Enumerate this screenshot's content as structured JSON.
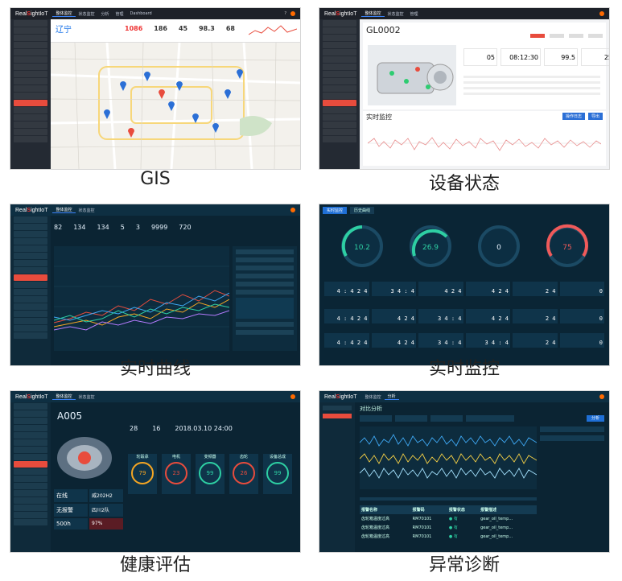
{
  "captions": [
    "GIS",
    "设备状态",
    "实时曲线",
    "实时监控",
    "健康评估",
    "异常诊断"
  ],
  "brand": "RealSightIoT",
  "gis": {
    "region": "辽宁",
    "stats": [
      {
        "value": "1086",
        "color": "#e33"
      },
      {
        "value": "186"
      },
      {
        "value": "45"
      },
      {
        "value": "98.3"
      },
      {
        "value": "68"
      }
    ],
    "nav": [
      "整体监控",
      "状态监控",
      "分析",
      "管理",
      "Dashboard"
    ]
  },
  "device": {
    "id": "GL0002",
    "realtime_title": "实时监控",
    "gauges": [
      "05",
      "08:12:30",
      "99.5",
      "25"
    ],
    "buttons": [
      "操作日志",
      "导出"
    ]
  },
  "curve": {
    "kpis": [
      "82",
      "134",
      "134",
      "5",
      "3",
      "9999",
      "720"
    ],
    "legend": [
      "实时曲线数据"
    ]
  },
  "monitor": {
    "tabs": [
      "实时监控",
      "历史曲线"
    ],
    "gauges": [
      {
        "value": "10.2",
        "color": "#2ecfa3"
      },
      {
        "value": "26.9",
        "color": "#2ecfa3"
      },
      {
        "value": "0",
        "color": "#8aa"
      },
      {
        "value": "75",
        "color": "#f05a5a"
      }
    ],
    "digits": [
      "4 : 4 2 4",
      "3 4 : 4",
      "4 2 4",
      "2 4",
      "0"
    ]
  },
  "health": {
    "id": "A005",
    "date": "2018.03.10 24:00",
    "rings": [
      {
        "label": "轮毂承",
        "value": "79"
      },
      {
        "label": "电机",
        "value": "23"
      },
      {
        "label": "变频器",
        "value": "99"
      },
      {
        "label": "齿轮",
        "value": "26"
      },
      {
        "label": "设备总成",
        "value": "99"
      }
    ],
    "status": [
      {
        "label": "在线",
        "value": "威202H2"
      },
      {
        "label": "无报警",
        "value": "四川2队"
      },
      {
        "label": "500h",
        "value": "97%"
      }
    ],
    "nums": [
      "28",
      "16"
    ]
  },
  "diag": {
    "title": "对比分析",
    "button": "分析",
    "table_headers": [
      "报警名称",
      "报警码",
      "报警状态",
      "报警描述"
    ],
    "rows": [
      [
        "齿轮箱温度过高",
        "RM70101",
        "● 有",
        "gear_oil_temp..."
      ],
      [
        "齿轮箱温度过高",
        "RM70101",
        "● 有",
        "gear_oil_temp..."
      ],
      [
        "齿轮箱温度过高",
        "RM70101",
        "● 有",
        "gear_oil_temp..."
      ]
    ]
  },
  "colors": {
    "dark_blue": "#0b2433",
    "teal": "#2ecfa3",
    "red": "#e84c3d",
    "accent": "#3b82f6"
  }
}
